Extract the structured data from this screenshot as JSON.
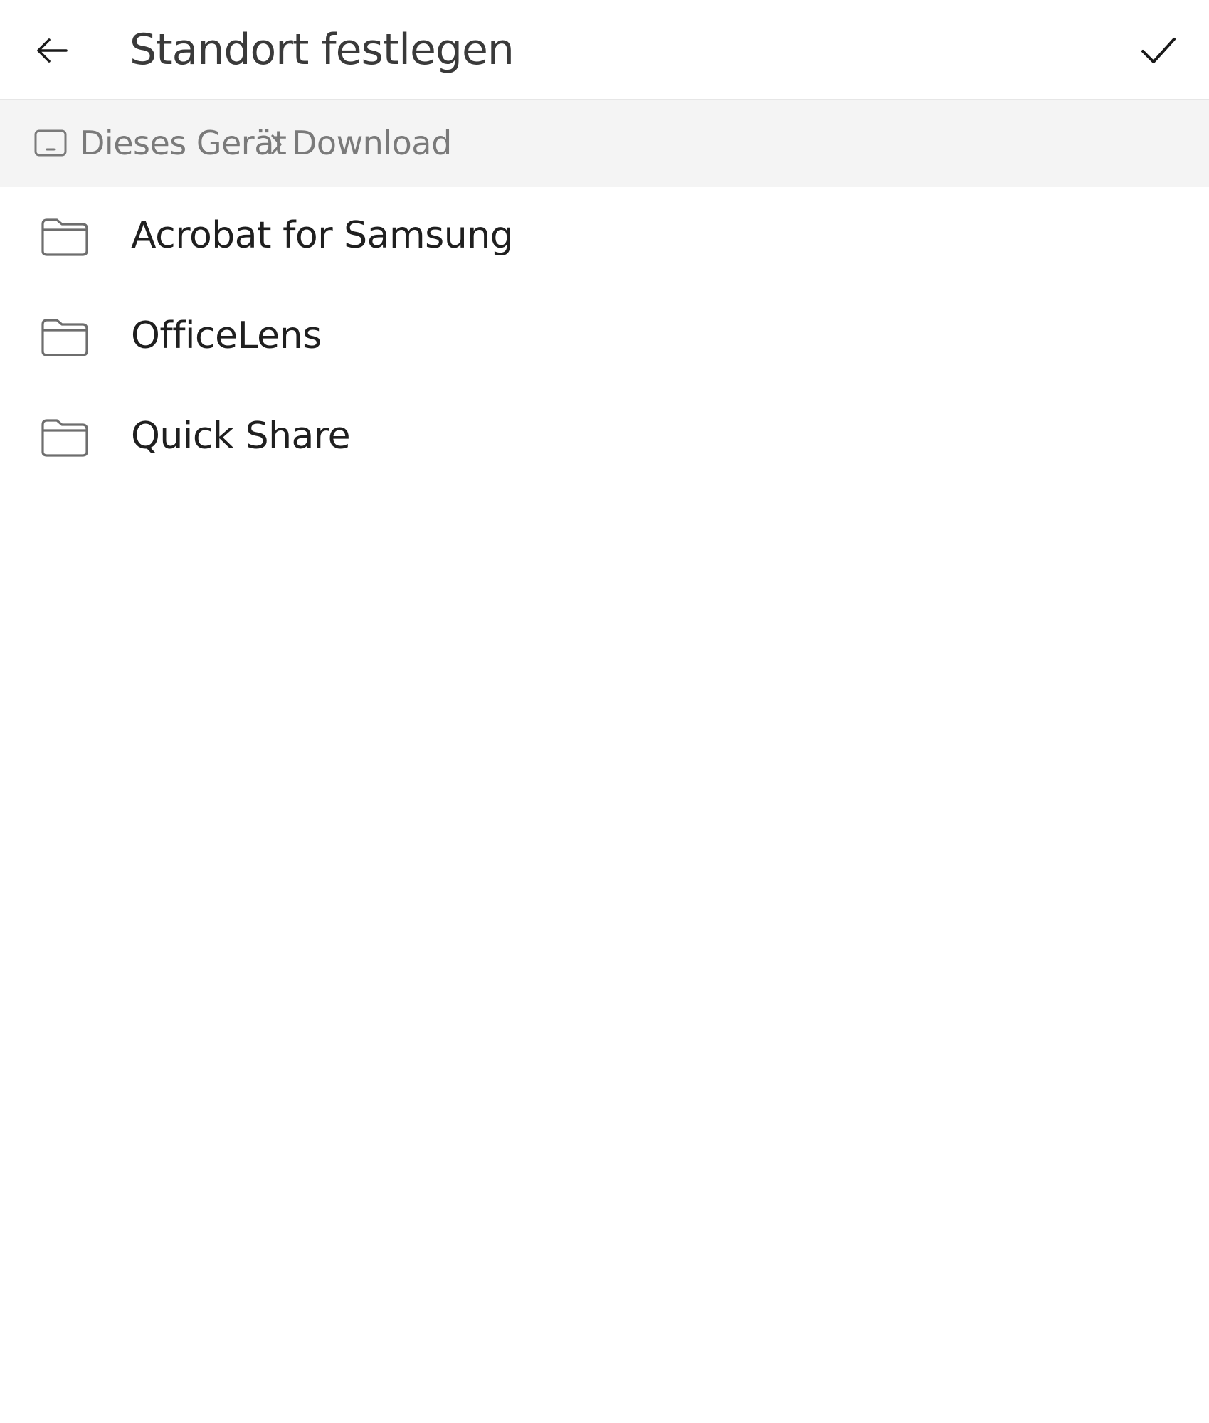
{
  "header": {
    "title": "Standort festlegen",
    "back_icon": "arrow-left-icon",
    "confirm_icon": "checkmark-icon"
  },
  "breadcrumb": {
    "device_icon": "device-storage-icon",
    "items": [
      "Dieses Gerät",
      "Download"
    ],
    "separator_icon": "chevron-right-icon"
  },
  "folders": [
    {
      "label": "Acrobat for Samsung",
      "icon": "folder-icon"
    },
    {
      "label": "OfficeLens",
      "icon": "folder-icon"
    },
    {
      "label": "Quick Share",
      "icon": "folder-icon"
    }
  ],
  "colors": {
    "title_text": "#3a3a3a",
    "breadcrumb_bg": "#f4f4f4",
    "breadcrumb_text": "#7a7a7a",
    "folder_text": "#1f1f1f",
    "icon_stroke": "#6e6e6e"
  }
}
